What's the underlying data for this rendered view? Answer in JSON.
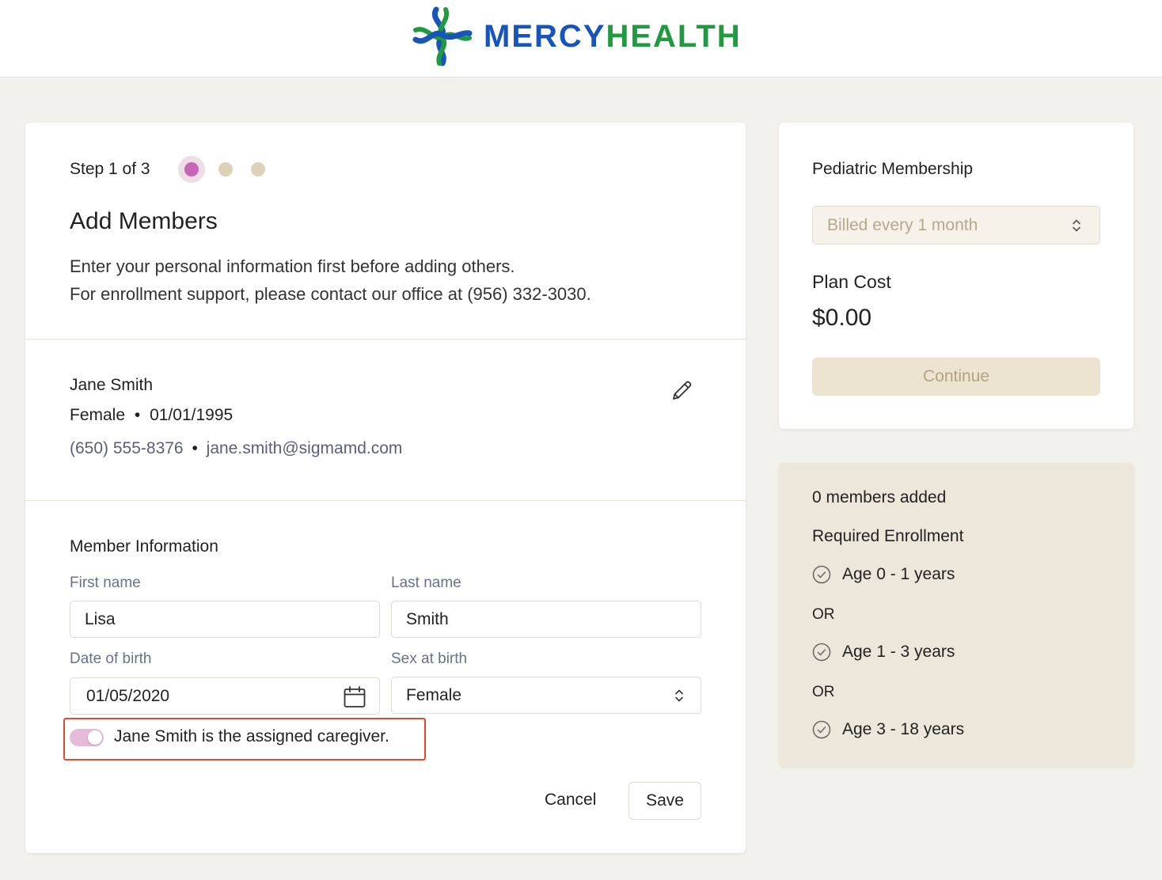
{
  "brand": {
    "name_part1": "MERCY",
    "name_part2": "HEALTH",
    "colors": {
      "blue": "#1755b8",
      "green": "#1f9a3f"
    }
  },
  "stepper": {
    "label": "Step 1 of 3",
    "current": 1,
    "total": 3,
    "accent": "#c965b8"
  },
  "main": {
    "title": "Add Members",
    "intro_line1": "Enter your personal information first before adding others.",
    "intro_line2": "For enrollment support, please contact our office at (956) 332-3030."
  },
  "primary_member": {
    "name": "Jane Smith",
    "sex": "Female",
    "separator": "•",
    "dob": "01/01/1995",
    "phone": "(650) 555-8376",
    "email": "jane.smith@sigmamd.com",
    "edit_icon": "pencil-icon"
  },
  "member_form": {
    "title": "Member Information",
    "first_name": {
      "label": "First name",
      "value": "Lisa"
    },
    "last_name": {
      "label": "Last name",
      "value": "Smith"
    },
    "dob": {
      "label": "Date of birth",
      "value": "01/05/2020",
      "icon": "calendar-icon"
    },
    "sex": {
      "label": "Sex at birth",
      "value": "Female"
    },
    "caregiver_toggle": {
      "label": "Jane Smith is the assigned caregiver.",
      "on": true
    },
    "cancel_label": "Cancel",
    "save_label": "Save"
  },
  "plan": {
    "title": "Pediatric Membership",
    "billing_value": "Billed every 1 month",
    "cost_label": "Plan Cost",
    "cost": "$0.00",
    "continue_label": "Continue"
  },
  "enrollment": {
    "members_added": "0 members added",
    "required_title": "Required Enrollment",
    "or_label": "OR",
    "age_options": [
      "Age 0 - 1 years",
      "Age 1 - 3 years",
      "Age 3 - 18 years"
    ]
  },
  "annotation_color": "#e8472f"
}
